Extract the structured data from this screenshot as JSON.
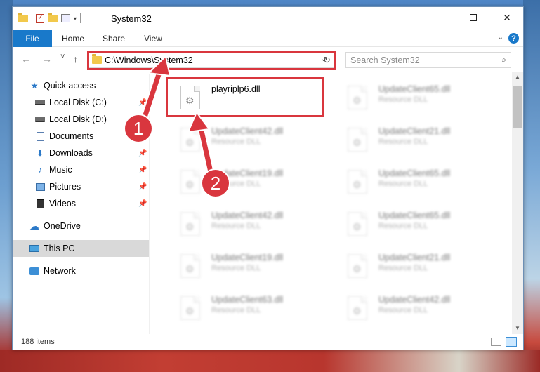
{
  "window": {
    "title": "System32",
    "controls": {
      "minimize": "minimize",
      "maximize": "maximize",
      "close": "✕"
    }
  },
  "ribbon": {
    "tabs": [
      "File",
      "Home",
      "Share",
      "View"
    ],
    "help_label": "?"
  },
  "navigation": {
    "back_icon": "←",
    "forward_icon": "→",
    "recent_icon": "˅",
    "up_icon": "↑",
    "address_path": "C:\\Windows\\System32",
    "refresh_icon": "↻",
    "search_placeholder": "Search System32",
    "search_icon": "⌕"
  },
  "sidebar": {
    "items": [
      {
        "label": "Quick access",
        "icon": "star-icon",
        "pinned": false
      },
      {
        "label": "Local Disk (C:)",
        "icon": "drive-icon",
        "pinned": true
      },
      {
        "label": "Local Disk (D:)",
        "icon": "drive-icon",
        "pinned": false
      },
      {
        "label": "Documents",
        "icon": "documents-icon",
        "pinned": true
      },
      {
        "label": "Downloads",
        "icon": "downloads-icon",
        "pinned": true
      },
      {
        "label": "Music",
        "icon": "music-icon",
        "pinned": true
      },
      {
        "label": "Pictures",
        "icon": "pictures-icon",
        "pinned": true
      },
      {
        "label": "Videos",
        "icon": "videos-icon",
        "pinned": true
      },
      {
        "label": "OneDrive",
        "icon": "onedrive-icon",
        "pinned": false
      },
      {
        "label": "This PC",
        "icon": "this-pc-icon",
        "pinned": false,
        "selected": true
      },
      {
        "label": "Network",
        "icon": "network-icon",
        "pinned": false
      }
    ]
  },
  "files": {
    "left_column": [
      {
        "name": "playriplp6.dll",
        "type": ""
      },
      {
        "name": "UpdateClient42.dll",
        "type": "Resource DLL"
      },
      {
        "name": "UpdateClient19.dll",
        "type": "Resource DLL"
      },
      {
        "name": "UpdateClient42.dll",
        "type": "Resource DLL"
      },
      {
        "name": "UpdateClient19.dll",
        "type": "Resource DLL"
      },
      {
        "name": "UpdateClient63.dll",
        "type": "Resource DLL"
      }
    ],
    "right_column": [
      {
        "name": "UpdateClient65.dll",
        "type": "Resource DLL"
      },
      {
        "name": "UpdateClient21.dll",
        "type": "Resource DLL"
      },
      {
        "name": "UpdateClient65.dll",
        "type": "Resource DLL"
      },
      {
        "name": "UpdateClient65.dll",
        "type": "Resource DLL"
      },
      {
        "name": "UpdateClient21.dll",
        "type": "Resource DLL"
      },
      {
        "name": "UpdateClient42.dll",
        "type": "Resource DLL"
      }
    ]
  },
  "status_bar": {
    "item_count": "188 items"
  },
  "callouts": {
    "first": "1",
    "second": "2"
  },
  "colors": {
    "accent": "#1979ca",
    "highlight_red": "#d9363e",
    "selected_nav": "#d9d9d9"
  }
}
